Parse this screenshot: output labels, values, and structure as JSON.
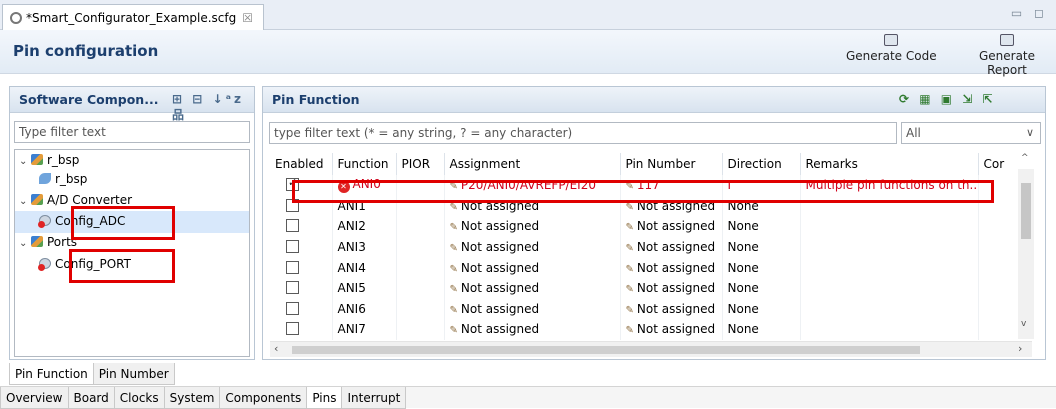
{
  "editor": {
    "tab_title": "*Smart_Configurator_Example.scfg",
    "close": "☒",
    "window_controls": "▭ ◻"
  },
  "header": {
    "title": "Pin configuration",
    "generate_code": "Generate Code",
    "generate_report": "Generate Report"
  },
  "left_panel": {
    "title": "Software Compon...",
    "tools": "⊞ ⊟ ↓ᵃz 品",
    "filter_placeholder": "Type filter text",
    "tree": {
      "r_bsp": "r_bsp",
      "r_bsp_child": "r_bsp",
      "ad_converter": "A/D Converter",
      "config_adc": "Config_ADC",
      "ports": "Ports",
      "config_port": "Config_PORT"
    }
  },
  "right_panel": {
    "title": "Pin Function",
    "filter_placeholder": "type filter text (* = any string, ? = any character)",
    "select_value": "All",
    "columns": [
      "Enabled",
      "Function",
      "PIOR",
      "Assignment",
      "Pin Number",
      "Direction",
      "Remarks",
      "Cor"
    ],
    "rows": [
      {
        "enabled": true,
        "function": "ANI0",
        "pior": "",
        "assignment": "P20/ANI0/AVREFP/EI20",
        "pin": "117",
        "direction": "I",
        "remarks": "Multiple pin functions on th..."
      },
      {
        "enabled": false,
        "function": "ANI1",
        "pior": "",
        "assignment": "Not assigned",
        "pin": "Not assigned",
        "direction": "None",
        "remarks": ""
      },
      {
        "enabled": false,
        "function": "ANI2",
        "pior": "",
        "assignment": "Not assigned",
        "pin": "Not assigned",
        "direction": "None",
        "remarks": ""
      },
      {
        "enabled": false,
        "function": "ANI3",
        "pior": "",
        "assignment": "Not assigned",
        "pin": "Not assigned",
        "direction": "None",
        "remarks": ""
      },
      {
        "enabled": false,
        "function": "ANI4",
        "pior": "",
        "assignment": "Not assigned",
        "pin": "Not assigned",
        "direction": "None",
        "remarks": ""
      },
      {
        "enabled": false,
        "function": "ANI5",
        "pior": "",
        "assignment": "Not assigned",
        "pin": "Not assigned",
        "direction": "None",
        "remarks": ""
      },
      {
        "enabled": false,
        "function": "ANI6",
        "pior": "",
        "assignment": "Not assigned",
        "pin": "Not assigned",
        "direction": "None",
        "remarks": ""
      },
      {
        "enabled": false,
        "function": "ANI7",
        "pior": "",
        "assignment": "Not assigned",
        "pin": "Not assigned",
        "direction": "None",
        "remarks": ""
      }
    ]
  },
  "bottom": {
    "view_tabs": [
      "Pin Function",
      "Pin Number"
    ],
    "page_tabs": [
      "Overview",
      "Board",
      "Clocks",
      "System",
      "Components",
      "Pins",
      "Interrupt"
    ]
  },
  "colors": {
    "error": "#d0021b",
    "highlight_box": "#e00000",
    "title_blue": "#1c3f6e"
  }
}
